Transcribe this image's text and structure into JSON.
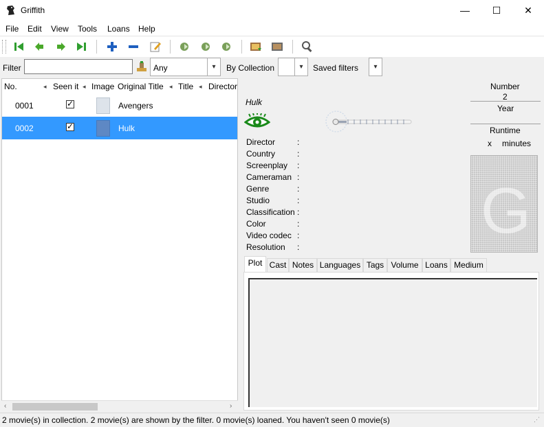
{
  "window": {
    "title": "Griffith",
    "minimize": "—",
    "maximize": "☐",
    "close": "✕"
  },
  "menu": [
    "File",
    "Edit",
    "View",
    "Tools",
    "Loans",
    "Help"
  ],
  "toolbar": {
    "icons": [
      "first-icon",
      "previous-icon",
      "next-icon",
      "last-icon",
      "add-icon",
      "remove-icon",
      "edit-icon",
      "update-icon",
      "update-tmdb-icon",
      "update-other-icon",
      "poster-add-icon",
      "poster-remove-icon",
      "search-icon"
    ]
  },
  "filter": {
    "label": "Filter",
    "value": "",
    "criteria_value": "Any",
    "collection_label": "By Collection",
    "collection_value": "",
    "saved_label": "Saved filters",
    "saved_value": ""
  },
  "list": {
    "columns": [
      "No.",
      "Seen it",
      "Image",
      "Original Title",
      "Title",
      "Director"
    ],
    "rows": [
      {
        "number": "0001",
        "seen": true,
        "original_title": "Avengers",
        "selected": false
      },
      {
        "number": "0002",
        "seen": true,
        "original_title": "Hulk",
        "selected": true
      }
    ]
  },
  "details": {
    "title": "Hulk",
    "number_label": "Number",
    "number_value": "2",
    "year_label": "Year",
    "year_value": "",
    "runtime_label": "Runtime",
    "runtime_x": "x",
    "runtime_unit": "minutes",
    "poster_letter": "G",
    "fields": [
      {
        "label": "Director",
        "colon": ":"
      },
      {
        "label": "Country",
        "colon": ":"
      },
      {
        "label": "Screenplay",
        "colon": ":"
      },
      {
        "label": "Cameraman",
        "colon": ":"
      },
      {
        "label": "Genre",
        "colon": ":"
      },
      {
        "label": "Studio",
        "colon": ":"
      },
      {
        "label": "Classification",
        "colon": ":"
      },
      {
        "label": "Color",
        "colon": ":"
      },
      {
        "label": "Video codec",
        "colon": ":"
      },
      {
        "label": "Resolution",
        "colon": ":"
      }
    ],
    "rating_fraction": 0.0
  },
  "tabs": [
    "Plot",
    "Cast",
    "Notes",
    "Languages",
    "Tags",
    "Volume",
    "Loans",
    "Medium"
  ],
  "active_tab": "Plot",
  "status": "2 movie(s) in collection. 2 movie(s) are shown by the filter. 0 movie(s) loaned. You haven't seen 0 movie(s)",
  "colors": {
    "selection": "#3399ff",
    "seen_icon": "#1a8a1a",
    "toolbar_green": "#2f9e2f",
    "toolbar_blue": "#1e5fbf"
  }
}
